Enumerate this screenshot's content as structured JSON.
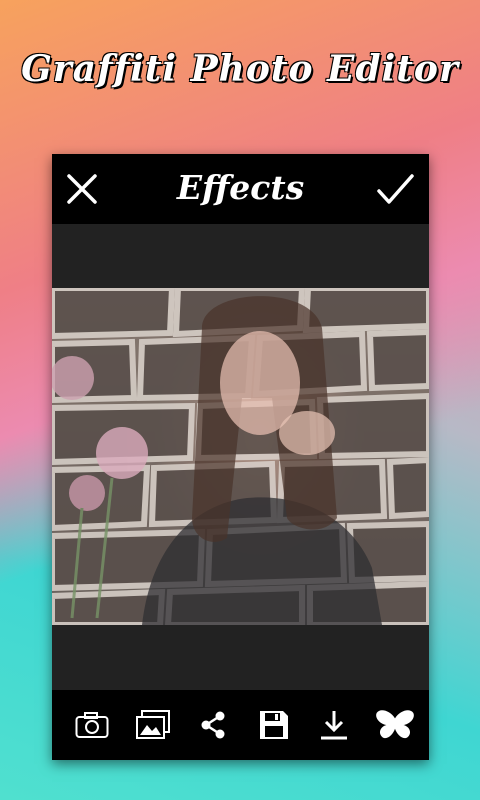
{
  "app_title": "Graffiti Photo Editor",
  "toolbar": {
    "title": "Effects",
    "close_icon": "close-icon",
    "confirm_icon": "check-icon"
  },
  "bottom_tools": [
    {
      "name": "camera",
      "icon": "camera-icon"
    },
    {
      "name": "gallery",
      "icon": "gallery-icon"
    },
    {
      "name": "share",
      "icon": "share-icon"
    },
    {
      "name": "save",
      "icon": "save-icon"
    },
    {
      "name": "download",
      "icon": "download-icon"
    },
    {
      "name": "effects",
      "icon": "butterfly-icon"
    }
  ],
  "colors": {
    "bar_background": "#000000",
    "panel_background": "#1b1b1b",
    "icon_color": "#ffffff"
  }
}
